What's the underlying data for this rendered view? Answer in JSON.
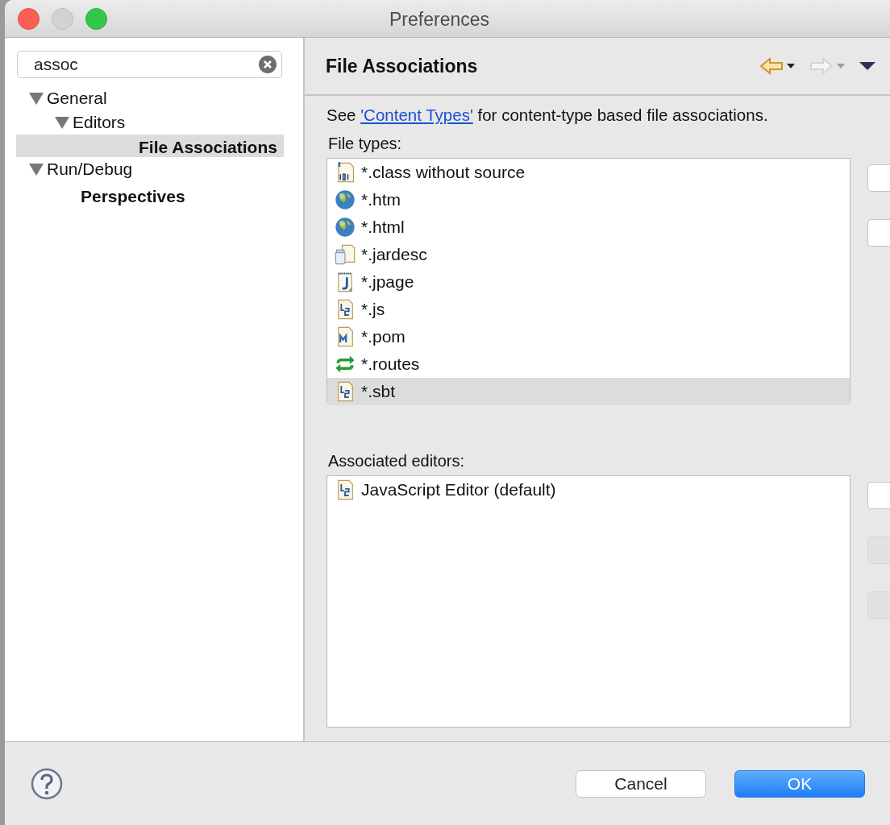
{
  "window": {
    "title": "Preferences"
  },
  "search": {
    "value": "assoc"
  },
  "tree": [
    {
      "label": "General",
      "expanded": true,
      "bold": false,
      "selected": false,
      "children": [
        {
          "label": "Editors",
          "expanded": true,
          "bold": false,
          "selected": false,
          "children": [
            {
              "label": "File Associations",
              "bold": true,
              "selected": true
            }
          ]
        }
      ]
    },
    {
      "label": "Run/Debug",
      "expanded": true,
      "bold": false,
      "selected": false,
      "children": [
        {
          "label": "Perspectives",
          "bold": true,
          "selected": false
        }
      ]
    }
  ],
  "page": {
    "title": "File Associations",
    "intro": {
      "before": "See ",
      "link": "'Content Types'",
      "after": " for content-type based file associations."
    },
    "file_types_label": "File types:",
    "file_types": [
      {
        "kind": "binary",
        "label": "*.class without source",
        "selected": false
      },
      {
        "kind": "globe",
        "label": "*.htm",
        "selected": false
      },
      {
        "kind": "globe",
        "label": "*.html",
        "selected": false
      },
      {
        "kind": "jar",
        "label": "*.jardesc",
        "selected": false
      },
      {
        "kind": "jpage",
        "label": "*.jpage",
        "selected": false
      },
      {
        "kind": "script",
        "label": "*.js",
        "selected": false
      },
      {
        "kind": "maven",
        "label": "*.pom",
        "selected": false
      },
      {
        "kind": "arrows",
        "label": "*.routes",
        "selected": false
      },
      {
        "kind": "script",
        "label": "*.sbt",
        "selected": true
      }
    ],
    "file_type_buttons": [
      {
        "disabled": false
      },
      {
        "disabled": false
      }
    ],
    "editors_label": "Associated editors:",
    "editors": [
      {
        "kind": "script",
        "label": "JavaScript Editor (default)",
        "selected": false
      }
    ],
    "editor_buttons": [
      {
        "disabled": false
      },
      {
        "disabled": true
      },
      {
        "disabled": true
      }
    ]
  },
  "buttons": [
    {
      "label": "Cancel",
      "default": false
    },
    {
      "label": "OK",
      "default": true
    }
  ]
}
